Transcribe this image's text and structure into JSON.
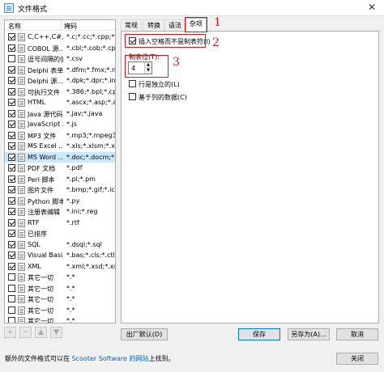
{
  "window": {
    "title": "文件格式",
    "close_glyph": "✕"
  },
  "list": {
    "columns": [
      "名称",
      "掩码"
    ],
    "rows": [
      {
        "name": "C,C++,C#,...",
        "mask": "*.c;*.cc;*.cpp;*.",
        "checked": true,
        "selected": false
      },
      {
        "name": "COBOL 源...",
        "mask": "*.cbl;*.cob;*.cpy*",
        "checked": true,
        "selected": false
      },
      {
        "name": "逗号间隔的值",
        "mask": "*.csv",
        "checked": false,
        "selected": false
      },
      {
        "name": "Delphi 表单",
        "mask": "*.dfm;*.fmx;*.nfr...",
        "checked": true,
        "selected": false
      },
      {
        "name": "Delphi 源...",
        "mask": "*.dpk;*.dpr;*.inc...",
        "checked": true,
        "selected": false
      },
      {
        "name": "可执行文件",
        "mask": "*.386;*.bpl;*.cpl;...",
        "checked": true,
        "selected": false
      },
      {
        "name": "HTML",
        "mask": "*.ascx;*.asp;*.asp...",
        "checked": true,
        "selected": false
      },
      {
        "name": "Java 源代码",
        "mask": "*.jav;*.java",
        "checked": true,
        "selected": false
      },
      {
        "name": "JavaScript ...",
        "mask": "*.js",
        "checked": true,
        "selected": false
      },
      {
        "name": "MP3 文件",
        "mask": "*.mp3;*.mpeg3...",
        "checked": true,
        "selected": false
      },
      {
        "name": "MS Excel ...",
        "mask": "*.xls;*.xlsm;*.xls...",
        "checked": true,
        "selected": false
      },
      {
        "name": "MS Word ...",
        "mask": "*.doc;*.docm;*.d...",
        "checked": true,
        "selected": true
      },
      {
        "name": "PDF 文档",
        "mask": "*.pdf",
        "checked": true,
        "selected": false
      },
      {
        "name": "Perl 脚本",
        "mask": "*.pl;*.pm",
        "checked": true,
        "selected": false
      },
      {
        "name": "图片文件",
        "mask": "*.bmp;*.gif;*.ic...",
        "checked": true,
        "selected": false
      },
      {
        "name": "Python 脚本",
        "mask": "*.py",
        "checked": true,
        "selected": false
      },
      {
        "name": "注册表编辑",
        "mask": "*.ini;*.reg",
        "checked": true,
        "selected": false
      },
      {
        "name": "RTF",
        "mask": "*.rtf",
        "checked": true,
        "selected": false
      },
      {
        "name": "已排序",
        "mask": "",
        "checked": true,
        "selected": false
      },
      {
        "name": "SQL",
        "mask": "*.dsql;*.sql",
        "checked": true,
        "selected": false
      },
      {
        "name": "Visual Basi...",
        "mask": "*.bas;*.cls;*.ctl;...",
        "checked": true,
        "selected": false
      },
      {
        "name": "XML",
        "mask": "*.xml;*.xsd;*.xsl",
        "checked": true,
        "selected": false
      },
      {
        "name": "其它一切",
        "mask": "*.*",
        "checked": false,
        "selected": false
      },
      {
        "name": "其它一切",
        "mask": "*.*",
        "checked": false,
        "selected": false
      },
      {
        "name": "其它一切",
        "mask": "*.*",
        "checked": false,
        "selected": false
      },
      {
        "name": "其它一切",
        "mask": "*.*",
        "checked": false,
        "selected": false
      },
      {
        "name": "其它一切",
        "mask": "*.*",
        "checked": false,
        "selected": false
      }
    ],
    "buttons": [
      "+",
      "−",
      "▲",
      "▼"
    ]
  },
  "tabs": [
    {
      "label": "常规",
      "active": false
    },
    {
      "label": "转换",
      "active": false
    },
    {
      "label": "语法",
      "active": false
    },
    {
      "label": "杂项",
      "active": true
    }
  ],
  "misc": {
    "insert_spaces_label": "插入空格而不是制表符(I)",
    "insert_spaces_checked": true,
    "tab_stop_label": "制表位(T):",
    "tab_stop_value": "4",
    "line_independent_label": "行是独立的(L)",
    "line_independent_checked": false,
    "column_data_label": "基于列的数据(C)",
    "column_data_checked": false
  },
  "annotations": [
    "1",
    "2",
    "3"
  ],
  "annotation_color": "#e0141b",
  "actions": {
    "factory_default": "出厂默认(D)",
    "save": "保存",
    "save_as": "另存为(A)...",
    "cancel": "取消",
    "close": "关闭"
  },
  "footer": {
    "prefix": "额外的文件格式可以在 ",
    "link": "Scooter Software 的网站",
    "suffix": "上找到。"
  }
}
